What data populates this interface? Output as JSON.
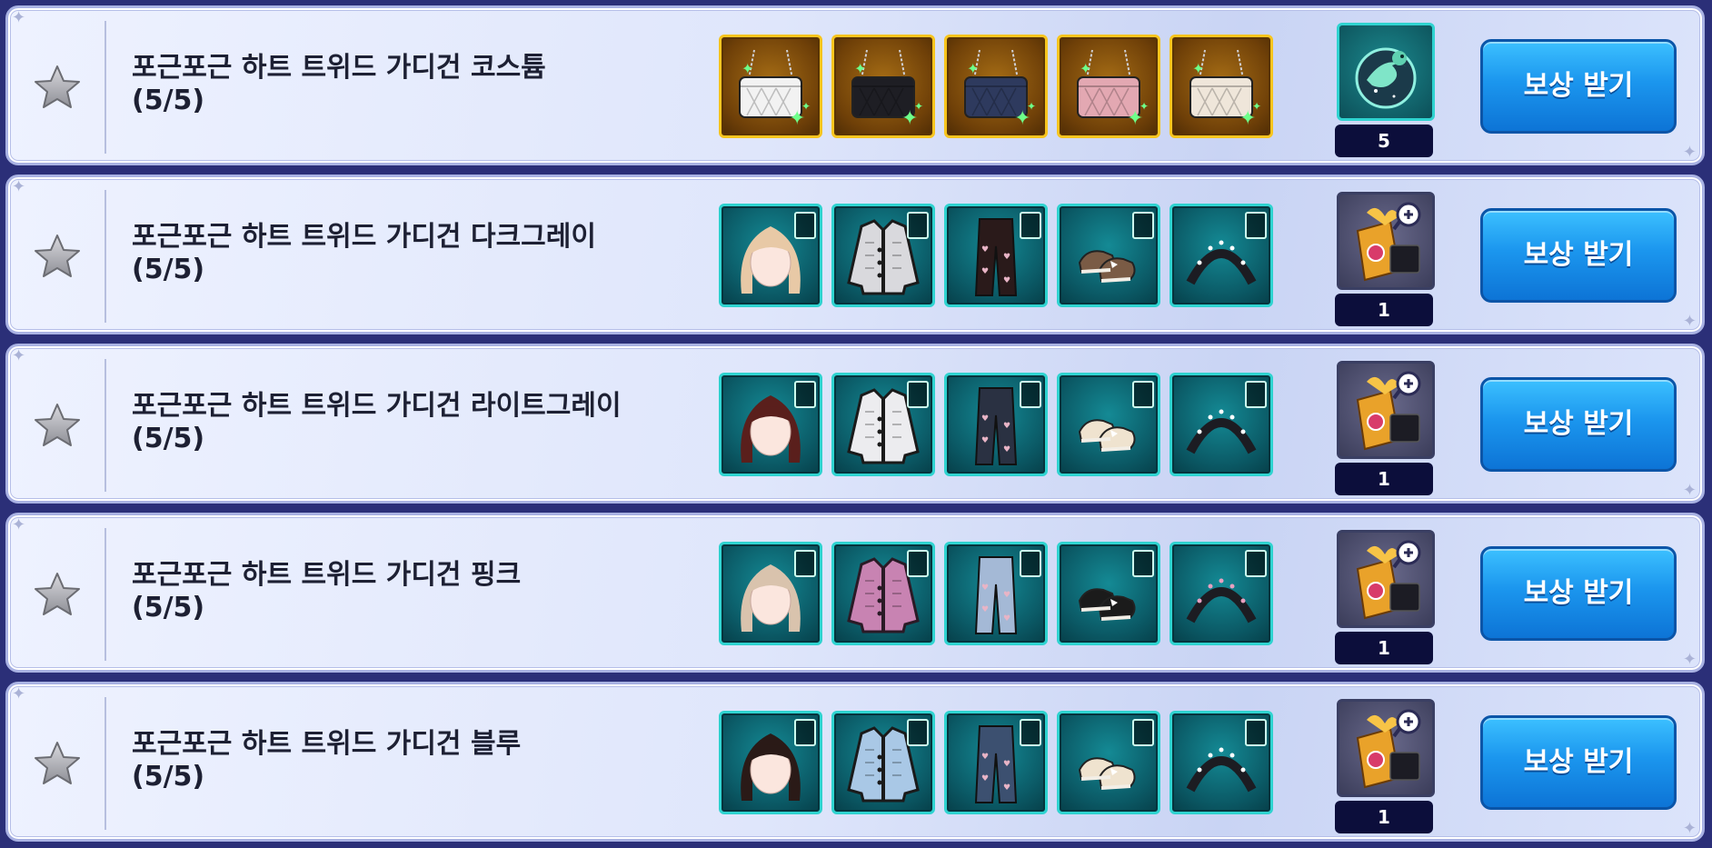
{
  "rows": [
    {
      "title": "포근포근 하트 트위드 가디건 코스튬",
      "progress": "(5/5)",
      "count": "5",
      "claim_label": "보상 받기",
      "reward_icon": "dragon-coin-icon",
      "items": [
        "white-bag-icon",
        "black-bag-icon",
        "navy-bag-icon",
        "pink-bag-icon",
        "cream-bag-icon"
      ]
    },
    {
      "title": "포근포근 하트 트위드 가디건 다크그레이",
      "progress": "(5/5)",
      "count": "1",
      "claim_label": "보상 받기",
      "reward_icon": "gift-box-magnifier-icon",
      "items": [
        "hair-icon",
        "cardigan-icon",
        "pants-icon",
        "shoes-icon",
        "headband-icon"
      ]
    },
    {
      "title": "포근포근 하트 트위드 가디건 라이트그레이",
      "progress": "(5/5)",
      "count": "1",
      "claim_label": "보상 받기",
      "reward_icon": "gift-box-magnifier-icon",
      "items": [
        "hair-icon",
        "cardigan-icon",
        "pants-icon",
        "shoes-icon",
        "headband-icon"
      ]
    },
    {
      "title": "포근포근 하트 트위드 가디건 핑크",
      "progress": "(5/5)",
      "count": "1",
      "claim_label": "보상 받기",
      "reward_icon": "gift-box-magnifier-icon",
      "items": [
        "hair-icon",
        "cardigan-icon",
        "pants-icon",
        "shoes-icon",
        "headband-icon"
      ]
    },
    {
      "title": "포근포근 하트 트위드 가디건 블루",
      "progress": "(5/5)",
      "count": "1",
      "claim_label": "보상 받기",
      "reward_icon": "gift-box-magnifier-icon",
      "items": [
        "hair-icon",
        "cardigan-icon",
        "pants-icon",
        "shoes-icon",
        "headband-icon"
      ]
    }
  ],
  "colors": {
    "bag_colors": [
      "#f2f2f2",
      "#1e1e24",
      "#2e3a5e",
      "#e3a8b2",
      "#efe6da"
    ],
    "hair": [
      "#e8c9a6",
      "#5a1f1c",
      "#d9c3ad",
      "#2a1a17"
    ],
    "cardigan": [
      "#d9d9dd",
      "#ececef",
      "#c883b2",
      "#a9c8e6"
    ],
    "cardigan_trim": [
      "#1a1a1a",
      "#1a1a1a",
      "#2a1a26",
      "#1a1a1a"
    ],
    "pants": [
      "#2a1a1a",
      "#2a3142",
      "#a4b9d6",
      "#3c5070"
    ],
    "shoes": [
      "#7a5b45",
      "#efe3cf",
      "#1b1b1b",
      "#efe3cf"
    ],
    "headband_dots": [
      "#ffffff",
      "#ffffff",
      "#e8a0c0",
      "#ffffff"
    ]
  }
}
